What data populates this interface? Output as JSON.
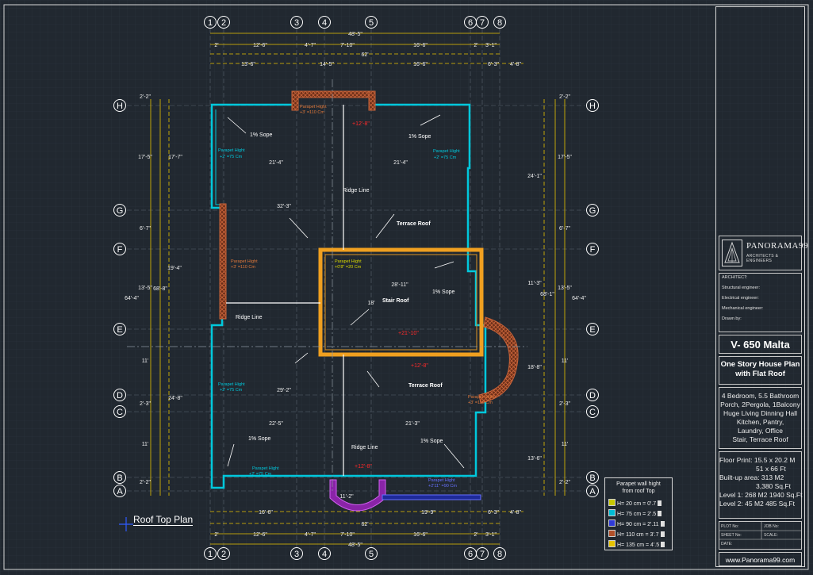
{
  "plan_title": "Roof Top Plan",
  "grid": {
    "columns": [
      "1",
      "2",
      "3",
      "4",
      "5",
      "6",
      "7",
      "8"
    ],
    "rows": [
      "H",
      "G",
      "F",
      "E",
      "D",
      "C",
      "B",
      "A"
    ]
  },
  "dims": {
    "top_total": "48'-5\"",
    "top_segments": [
      "2'",
      "12'-6\"",
      "4'-7\"",
      "7'-10\"",
      "16'-6\"",
      "2'",
      "3'-1\""
    ],
    "top_62": "62'",
    "top_lower": [
      "13'-6\"",
      "14'-5\"",
      "16'-6\"",
      "6'-3\"",
      "4'-8\""
    ],
    "bottom_total": "48'-5\"",
    "bottom_segments": [
      "2'",
      "12'-6\"",
      "4'-7\"",
      "7'-10\"",
      "16'-6\"",
      "2'",
      "3'-1\""
    ],
    "bottom_62": "62'",
    "bottom_upper": [
      "16'-6\"",
      "19'-9\"",
      "6'-3\"",
      "4'-8\""
    ],
    "left_rows": [
      "2'-2\"",
      "17'-5\"",
      "6'-7\"",
      "13'-5\"",
      "11'",
      "2'-3\"",
      "11'",
      "2'-2\""
    ],
    "left_total": "64'-4\"",
    "left_inner": [
      "17'-7\"",
      "19'-4\"",
      "24'-8\"",
      "68'-8\""
    ],
    "right_rows": [
      "2'-2\"",
      "17'-5\"",
      "6'-7\"",
      "13'-5\"",
      "11'",
      "2'-3\"",
      "11'",
      "2'-2\""
    ],
    "right_total": "64'-4\"",
    "right_inner": [
      "24'-1\"",
      "11'-3\"",
      "18'-8\"",
      "13'-6\"",
      "68'-1\""
    ],
    "interior": [
      "21'-4\"",
      "21'-4\"",
      "32'-3\"",
      "28'-11\"",
      "18'",
      "29'-2\"",
      "22'-5\"",
      "21'-3\"",
      "11'-2\""
    ]
  },
  "notes": {
    "slope": "1% Sope",
    "ridge_line": "Ridge Line",
    "terrace_roof": "Terrace Roof",
    "stair_roof": "Stair Roof",
    "parapet_75": [
      "Parapet Hight",
      "+2' =75 Cm"
    ],
    "parapet_110": [
      "Parapet Hight",
      "+3' =110 Cm"
    ],
    "parapet_20": [
      "Parapet Hight",
      "+0'8\" =20 Cm"
    ],
    "parapet_90": [
      "Parapet Hight",
      "+2'11\" =90 Cm"
    ],
    "levels": [
      "+12'-8\"",
      "+21'-10\"",
      "+12'-8\"",
      "+12'-8\""
    ]
  },
  "legend": {
    "title_line1": "Parapet wall hight",
    "title_line2": "from roof Top",
    "rows": [
      {
        "label": "H= 20 cm = 0'.7",
        "color": "#c8c800"
      },
      {
        "label": "H= 75 cm = 2'.5",
        "color": "#00bcd4"
      },
      {
        "label": "H= 90 cm = 2'.11",
        "color": "#2f3ad8"
      },
      {
        "label": "H= 110 cm = 3'.7",
        "color": "#b0502a"
      },
      {
        "label": "H= 135 cm = 4'.5",
        "color": "#e6c200"
      }
    ]
  },
  "title_block": {
    "company": "PANORAMA99",
    "company_sub": "ARCHITECTS & ENGINEERS",
    "roles": [
      "ARCHITECT:",
      "Structural engineer:",
      "Electrical engineer:",
      "Mechanical engineer:",
      "Drawn by:"
    ],
    "project_name": "V- 650 Malta",
    "plan_title": [
      "One Story House Plan",
      "with Flat Roof"
    ],
    "description": [
      "4 Bedroom, 5.5 Bathroom",
      "Porch, 2Pergola, 1Balcony",
      "Huge Living Dinning Hall",
      "Kitchen, Pantry,",
      "Laundry, Office",
      "Stair, Terrace Roof"
    ],
    "floor_print": "Floor Print: 15.5 x 20.2 M",
    "floor_print_ft": "51 x 66 Ft",
    "built_up": "Built-up area: 313 M2",
    "built_up_ft": "3,380 Sq.Ft",
    "level1": "Level 1: 268 M2  1940 Sq.Ft",
    "level2": "Level 2:   45 M2   485 Sq.Ft",
    "meta_labels": [
      "PLOT No:",
      "JOB No:",
      "SHEET No:",
      "SCALE:",
      "DATE:"
    ],
    "website": "www.Panorama99.com"
  },
  "colors": {
    "background": "#212830",
    "grid_line": "#2f3842",
    "dimension": "#e8c200",
    "cyan_wall": "#00c8dc",
    "brick": "#b0502a",
    "stair_wall": "#f0a020",
    "magenta": "#c040e0",
    "level_text": "#ff2a2a"
  }
}
